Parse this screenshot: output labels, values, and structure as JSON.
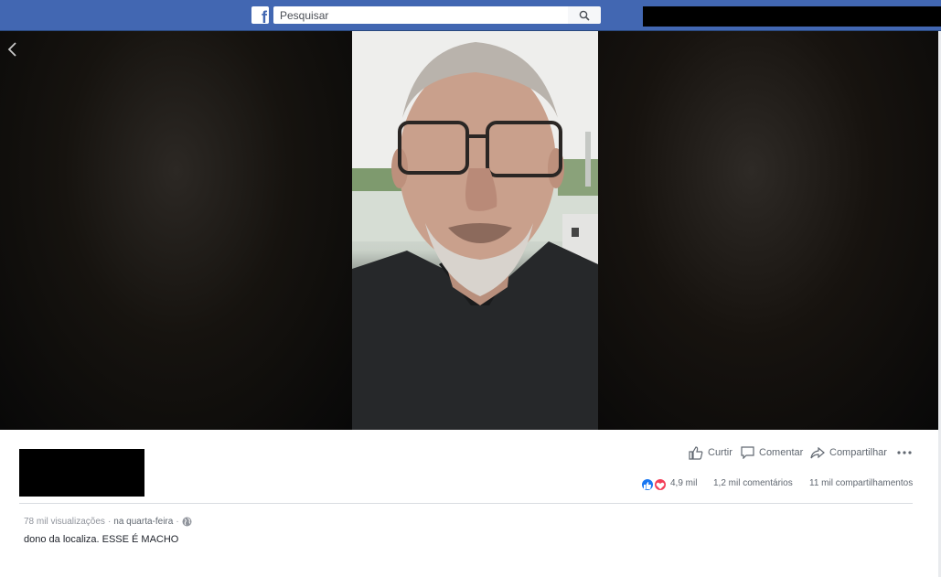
{
  "topbar": {
    "logo_letter": "f",
    "search_placeholder": "Pesquisar",
    "search_icon": "search-icon"
  },
  "player": {
    "back_icon": "chevron-left-icon"
  },
  "post": {
    "actions": {
      "like_label": "Curtir",
      "comment_label": "Comentar",
      "share_label": "Compartilhar",
      "more_icon": "more-dots-icon"
    },
    "stats": {
      "reactions_count": "4,9 mil",
      "comments": "1,2 mil comentários",
      "shares": "11 mil compartilhamentos"
    },
    "meta": {
      "views": "78 mil visualizações",
      "separator": "·",
      "date": "na quarta-feira",
      "privacy_icon": "globe-icon"
    },
    "caption": "dono da localiza. ESSE É MACHO"
  },
  "colors": {
    "brand": "#4267b2",
    "like": "#1877f2",
    "love": "#f33e58"
  }
}
